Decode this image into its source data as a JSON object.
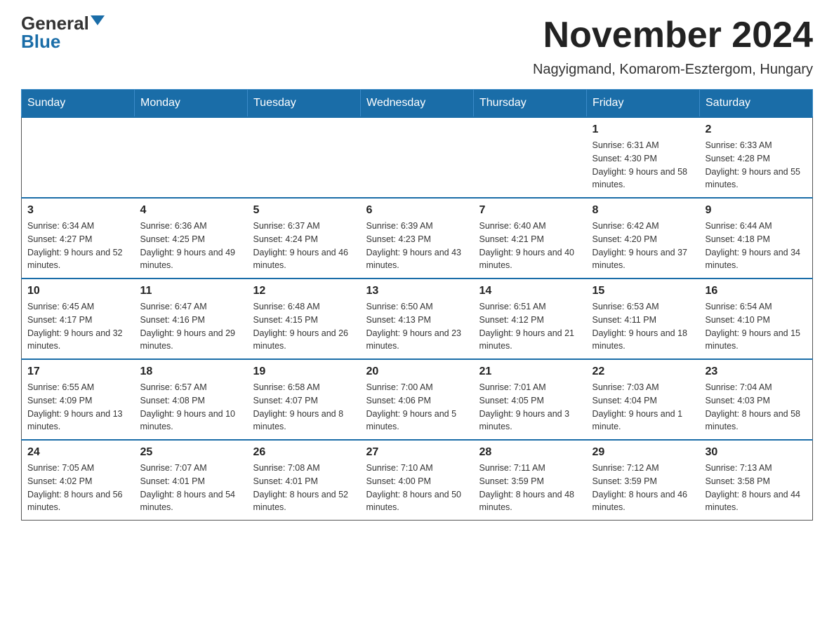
{
  "logo": {
    "general": "General",
    "blue": "Blue"
  },
  "title": "November 2024",
  "subtitle": "Nagyigmand, Komarom-Esztergom, Hungary",
  "weekdays": [
    "Sunday",
    "Monday",
    "Tuesday",
    "Wednesday",
    "Thursday",
    "Friday",
    "Saturday"
  ],
  "weeks": [
    [
      {
        "day": "",
        "info": ""
      },
      {
        "day": "",
        "info": ""
      },
      {
        "day": "",
        "info": ""
      },
      {
        "day": "",
        "info": ""
      },
      {
        "day": "",
        "info": ""
      },
      {
        "day": "1",
        "info": "Sunrise: 6:31 AM\nSunset: 4:30 PM\nDaylight: 9 hours and 58 minutes."
      },
      {
        "day": "2",
        "info": "Sunrise: 6:33 AM\nSunset: 4:28 PM\nDaylight: 9 hours and 55 minutes."
      }
    ],
    [
      {
        "day": "3",
        "info": "Sunrise: 6:34 AM\nSunset: 4:27 PM\nDaylight: 9 hours and 52 minutes."
      },
      {
        "day": "4",
        "info": "Sunrise: 6:36 AM\nSunset: 4:25 PM\nDaylight: 9 hours and 49 minutes."
      },
      {
        "day": "5",
        "info": "Sunrise: 6:37 AM\nSunset: 4:24 PM\nDaylight: 9 hours and 46 minutes."
      },
      {
        "day": "6",
        "info": "Sunrise: 6:39 AM\nSunset: 4:23 PM\nDaylight: 9 hours and 43 minutes."
      },
      {
        "day": "7",
        "info": "Sunrise: 6:40 AM\nSunset: 4:21 PM\nDaylight: 9 hours and 40 minutes."
      },
      {
        "day": "8",
        "info": "Sunrise: 6:42 AM\nSunset: 4:20 PM\nDaylight: 9 hours and 37 minutes."
      },
      {
        "day": "9",
        "info": "Sunrise: 6:44 AM\nSunset: 4:18 PM\nDaylight: 9 hours and 34 minutes."
      }
    ],
    [
      {
        "day": "10",
        "info": "Sunrise: 6:45 AM\nSunset: 4:17 PM\nDaylight: 9 hours and 32 minutes."
      },
      {
        "day": "11",
        "info": "Sunrise: 6:47 AM\nSunset: 4:16 PM\nDaylight: 9 hours and 29 minutes."
      },
      {
        "day": "12",
        "info": "Sunrise: 6:48 AM\nSunset: 4:15 PM\nDaylight: 9 hours and 26 minutes."
      },
      {
        "day": "13",
        "info": "Sunrise: 6:50 AM\nSunset: 4:13 PM\nDaylight: 9 hours and 23 minutes."
      },
      {
        "day": "14",
        "info": "Sunrise: 6:51 AM\nSunset: 4:12 PM\nDaylight: 9 hours and 21 minutes."
      },
      {
        "day": "15",
        "info": "Sunrise: 6:53 AM\nSunset: 4:11 PM\nDaylight: 9 hours and 18 minutes."
      },
      {
        "day": "16",
        "info": "Sunrise: 6:54 AM\nSunset: 4:10 PM\nDaylight: 9 hours and 15 minutes."
      }
    ],
    [
      {
        "day": "17",
        "info": "Sunrise: 6:55 AM\nSunset: 4:09 PM\nDaylight: 9 hours and 13 minutes."
      },
      {
        "day": "18",
        "info": "Sunrise: 6:57 AM\nSunset: 4:08 PM\nDaylight: 9 hours and 10 minutes."
      },
      {
        "day": "19",
        "info": "Sunrise: 6:58 AM\nSunset: 4:07 PM\nDaylight: 9 hours and 8 minutes."
      },
      {
        "day": "20",
        "info": "Sunrise: 7:00 AM\nSunset: 4:06 PM\nDaylight: 9 hours and 5 minutes."
      },
      {
        "day": "21",
        "info": "Sunrise: 7:01 AM\nSunset: 4:05 PM\nDaylight: 9 hours and 3 minutes."
      },
      {
        "day": "22",
        "info": "Sunrise: 7:03 AM\nSunset: 4:04 PM\nDaylight: 9 hours and 1 minute."
      },
      {
        "day": "23",
        "info": "Sunrise: 7:04 AM\nSunset: 4:03 PM\nDaylight: 8 hours and 58 minutes."
      }
    ],
    [
      {
        "day": "24",
        "info": "Sunrise: 7:05 AM\nSunset: 4:02 PM\nDaylight: 8 hours and 56 minutes."
      },
      {
        "day": "25",
        "info": "Sunrise: 7:07 AM\nSunset: 4:01 PM\nDaylight: 8 hours and 54 minutes."
      },
      {
        "day": "26",
        "info": "Sunrise: 7:08 AM\nSunset: 4:01 PM\nDaylight: 8 hours and 52 minutes."
      },
      {
        "day": "27",
        "info": "Sunrise: 7:10 AM\nSunset: 4:00 PM\nDaylight: 8 hours and 50 minutes."
      },
      {
        "day": "28",
        "info": "Sunrise: 7:11 AM\nSunset: 3:59 PM\nDaylight: 8 hours and 48 minutes."
      },
      {
        "day": "29",
        "info": "Sunrise: 7:12 AM\nSunset: 3:59 PM\nDaylight: 8 hours and 46 minutes."
      },
      {
        "day": "30",
        "info": "Sunrise: 7:13 AM\nSunset: 3:58 PM\nDaylight: 8 hours and 44 minutes."
      }
    ]
  ]
}
